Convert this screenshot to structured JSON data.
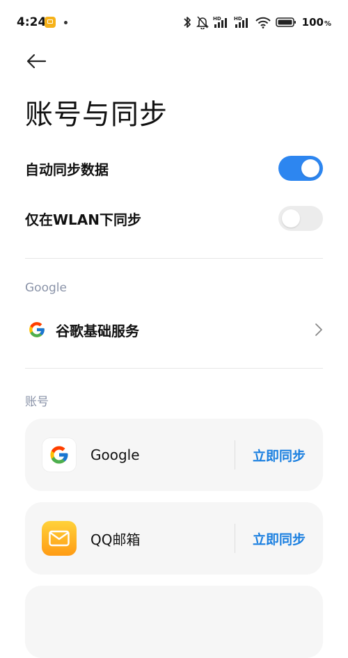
{
  "status_bar": {
    "time": "4:24",
    "battery": "100",
    "network_label": "HD"
  },
  "header": {
    "title": "账号与同步"
  },
  "settings": {
    "auto_sync": {
      "label": "自动同步数据",
      "enabled": true
    },
    "wlan_sync": {
      "label": "仅在WLAN下同步",
      "enabled": false
    }
  },
  "google_section": {
    "header": "Google",
    "service_label": "谷歌基础服务"
  },
  "accounts_section": {
    "header": "账号",
    "items": [
      {
        "name": "Google",
        "action": "立即同步"
      },
      {
        "name": "QQ邮箱",
        "action": "立即同步"
      }
    ]
  },
  "colors": {
    "accent": "#2d86f0",
    "sync_text": "#1a7fe0",
    "section_header": "#8a93a8"
  }
}
